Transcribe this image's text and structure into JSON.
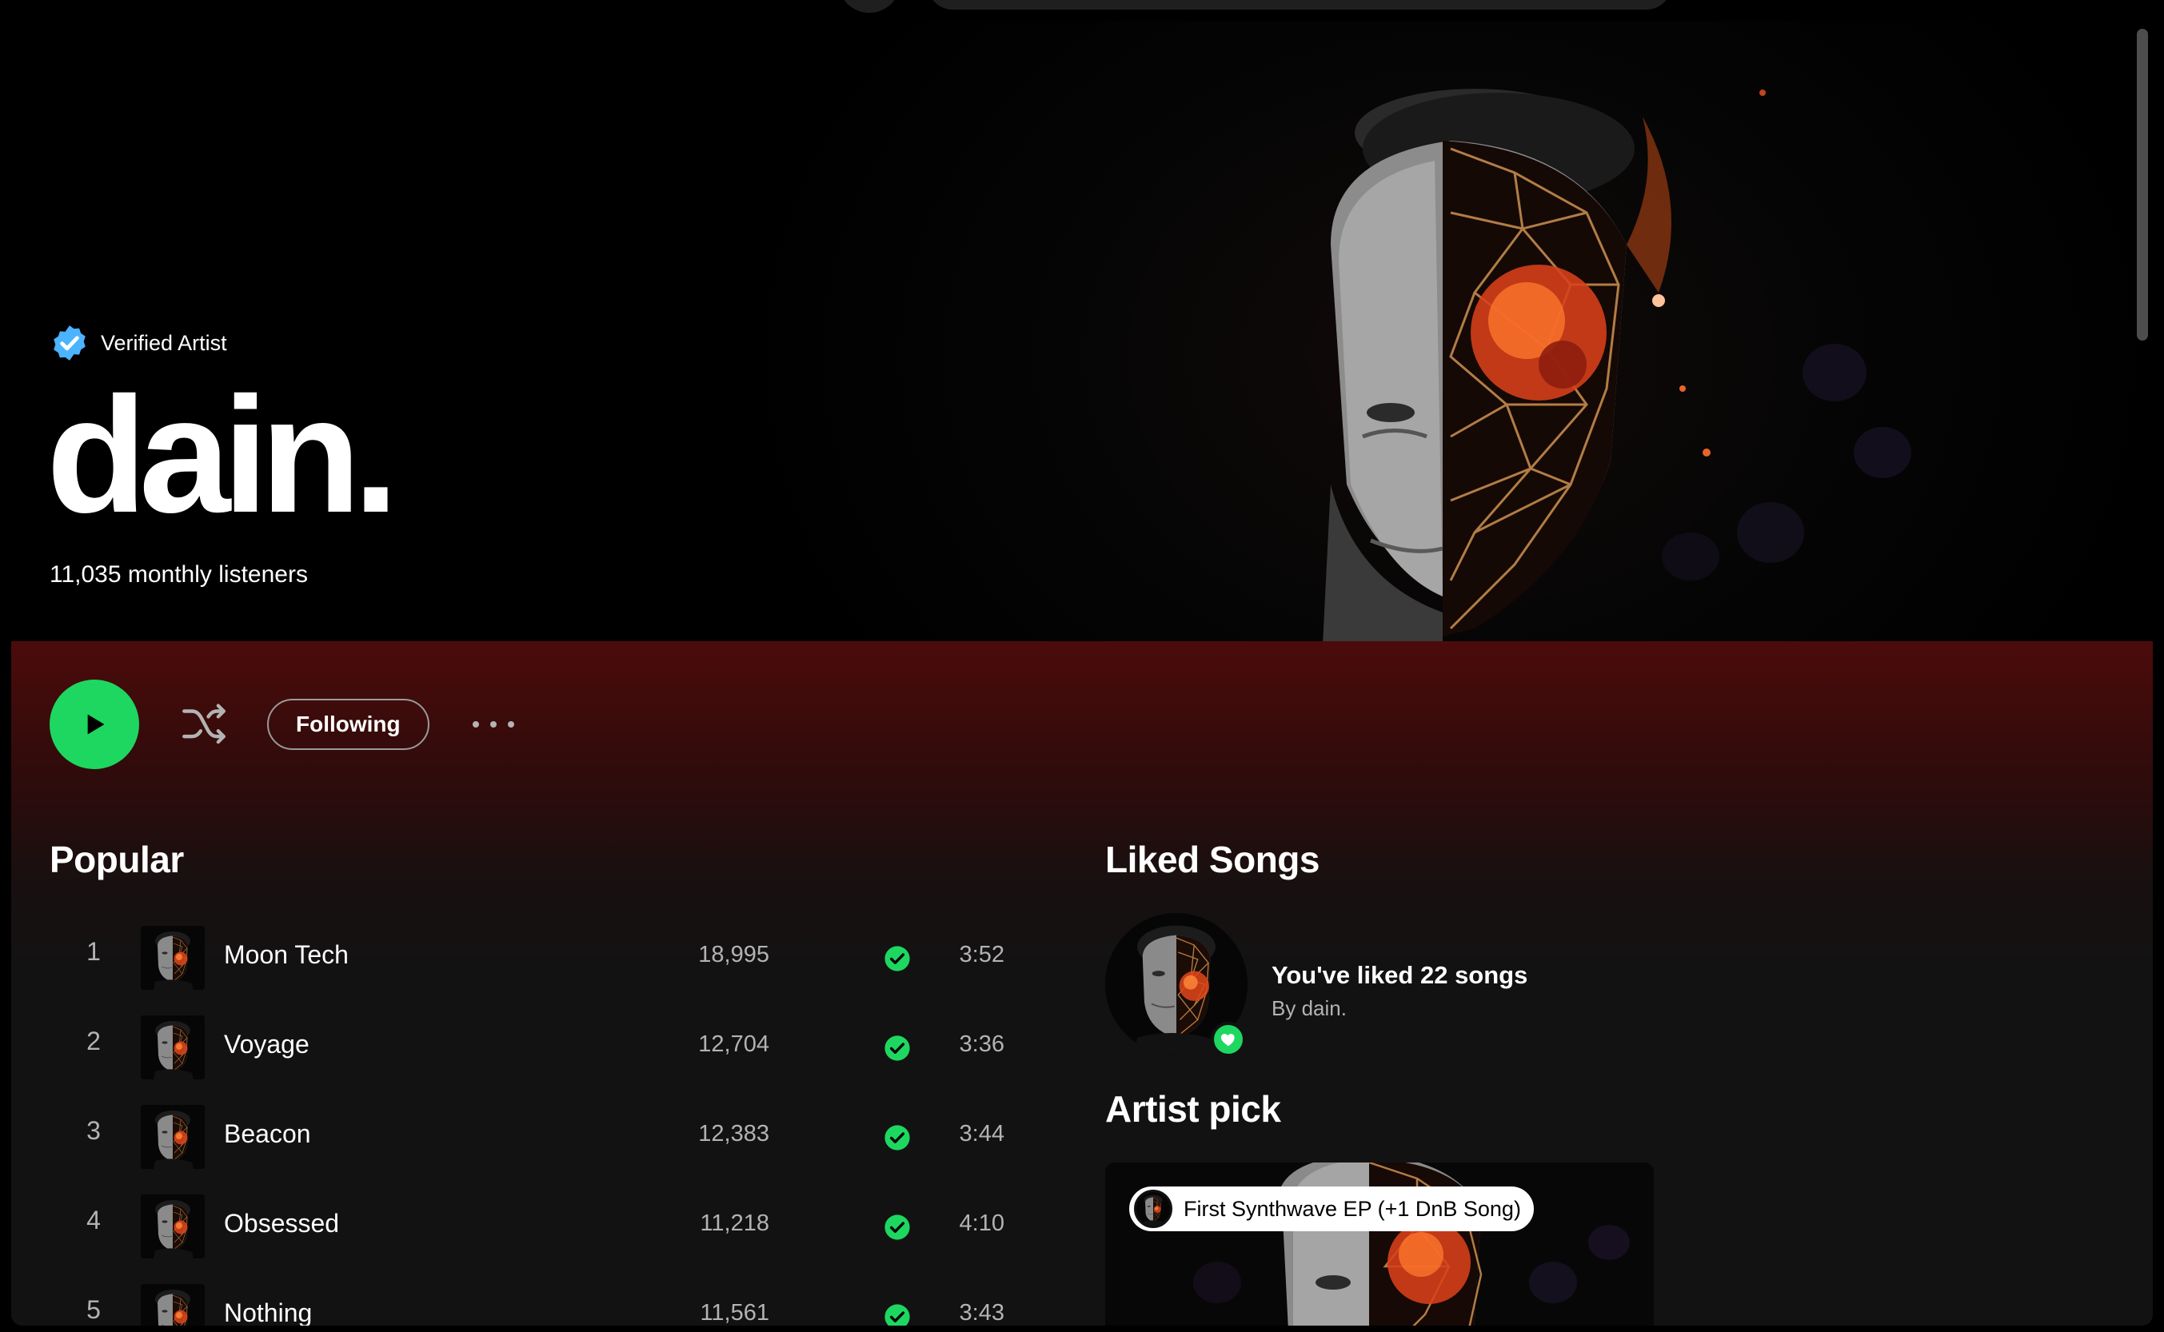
{
  "artist": {
    "verified_label": "Verified Artist",
    "name": "dain.",
    "monthly_listeners": "11,035 monthly listeners"
  },
  "actions": {
    "following_label": "Following"
  },
  "popular": {
    "title": "Popular",
    "tracks": [
      {
        "num": "1",
        "title": "Moon Tech",
        "plays": "18,995",
        "duration": "3:52",
        "liked": true
      },
      {
        "num": "2",
        "title": "Voyage",
        "plays": "12,704",
        "duration": "3:36",
        "liked": true
      },
      {
        "num": "3",
        "title": "Beacon",
        "plays": "12,383",
        "duration": "3:44",
        "liked": true
      },
      {
        "num": "4",
        "title": "Obsessed",
        "plays": "11,218",
        "duration": "4:10",
        "liked": true
      },
      {
        "num": "5",
        "title": "Nothing",
        "plays": "11,561",
        "duration": "3:43",
        "liked": true
      }
    ]
  },
  "liked_songs": {
    "title": "Liked Songs",
    "heading": "You've liked 22 songs",
    "subtitle": "By dain."
  },
  "artist_pick": {
    "title": "Artist pick",
    "tag_label": "First Synthwave EP (+1 DnB Song)"
  },
  "colors": {
    "accent_green": "#1ed760",
    "verified_blue": "#4cb3ff",
    "header_band": "#4c0b0b"
  },
  "icons": {
    "verified": "verified-badge-icon",
    "play": "play-icon",
    "shuffle": "shuffle-icon",
    "more": "more-options-icon",
    "liked_check": "check-circle-icon",
    "heart": "heart-icon"
  }
}
